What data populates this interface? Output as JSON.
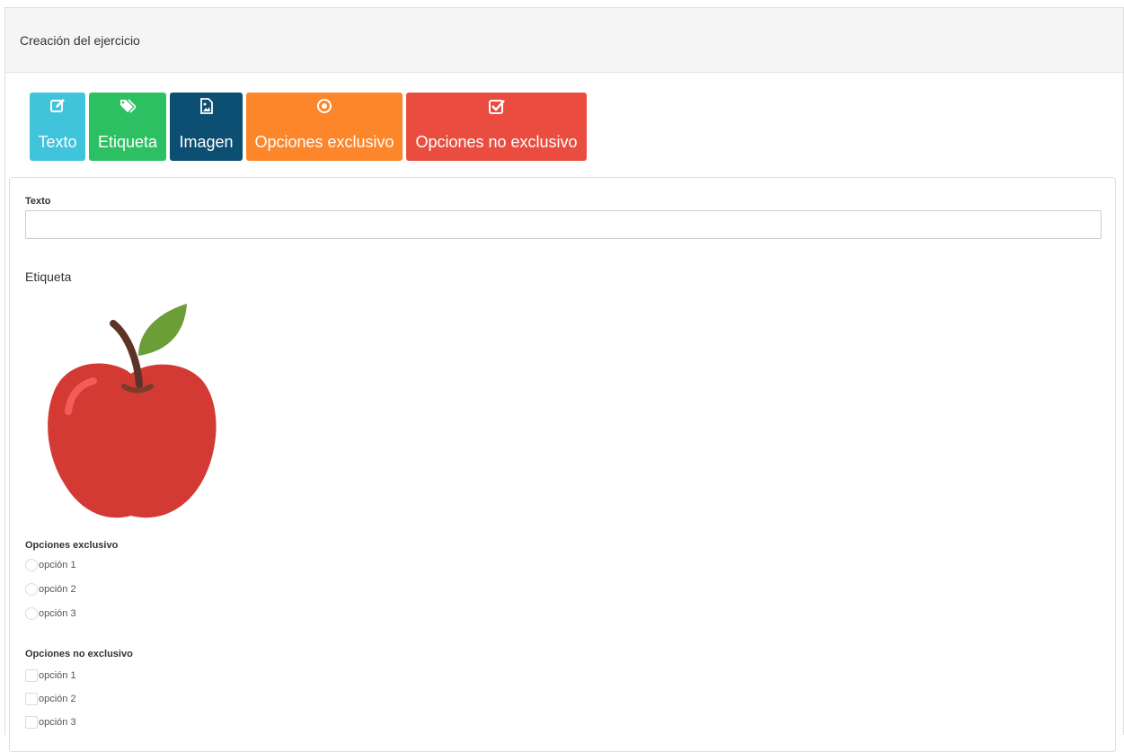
{
  "header": {
    "title": "Creación del ejercicio"
  },
  "toolbar": {
    "buttons": [
      {
        "label": "Texto",
        "icon": "edit-icon",
        "color": "#3fc4db"
      },
      {
        "label": "Etiqueta",
        "icon": "tags-icon",
        "color": "#2dc063"
      },
      {
        "label": "Imagen",
        "icon": "image-icon",
        "color": "#0c4f72"
      },
      {
        "label": "Opciones exclusivo",
        "icon": "radio-circle-icon",
        "color": "#fd852a"
      },
      {
        "label": "Opciones no exclusivo",
        "icon": "checkbox-icon",
        "color": "#ea4d40"
      }
    ]
  },
  "form": {
    "texto_label": "Texto",
    "texto_value": "",
    "etiqueta": "Etiqueta",
    "image": {
      "icon": "apple-image"
    },
    "exclusive": {
      "title": "Opciones exclusivo",
      "options": [
        "opción 1",
        "opción 2",
        "opción 3"
      ]
    },
    "non_exclusive": {
      "title": "Opciones no exclusivo",
      "options": [
        "opción 1",
        "opción 2",
        "opción 3"
      ]
    }
  }
}
